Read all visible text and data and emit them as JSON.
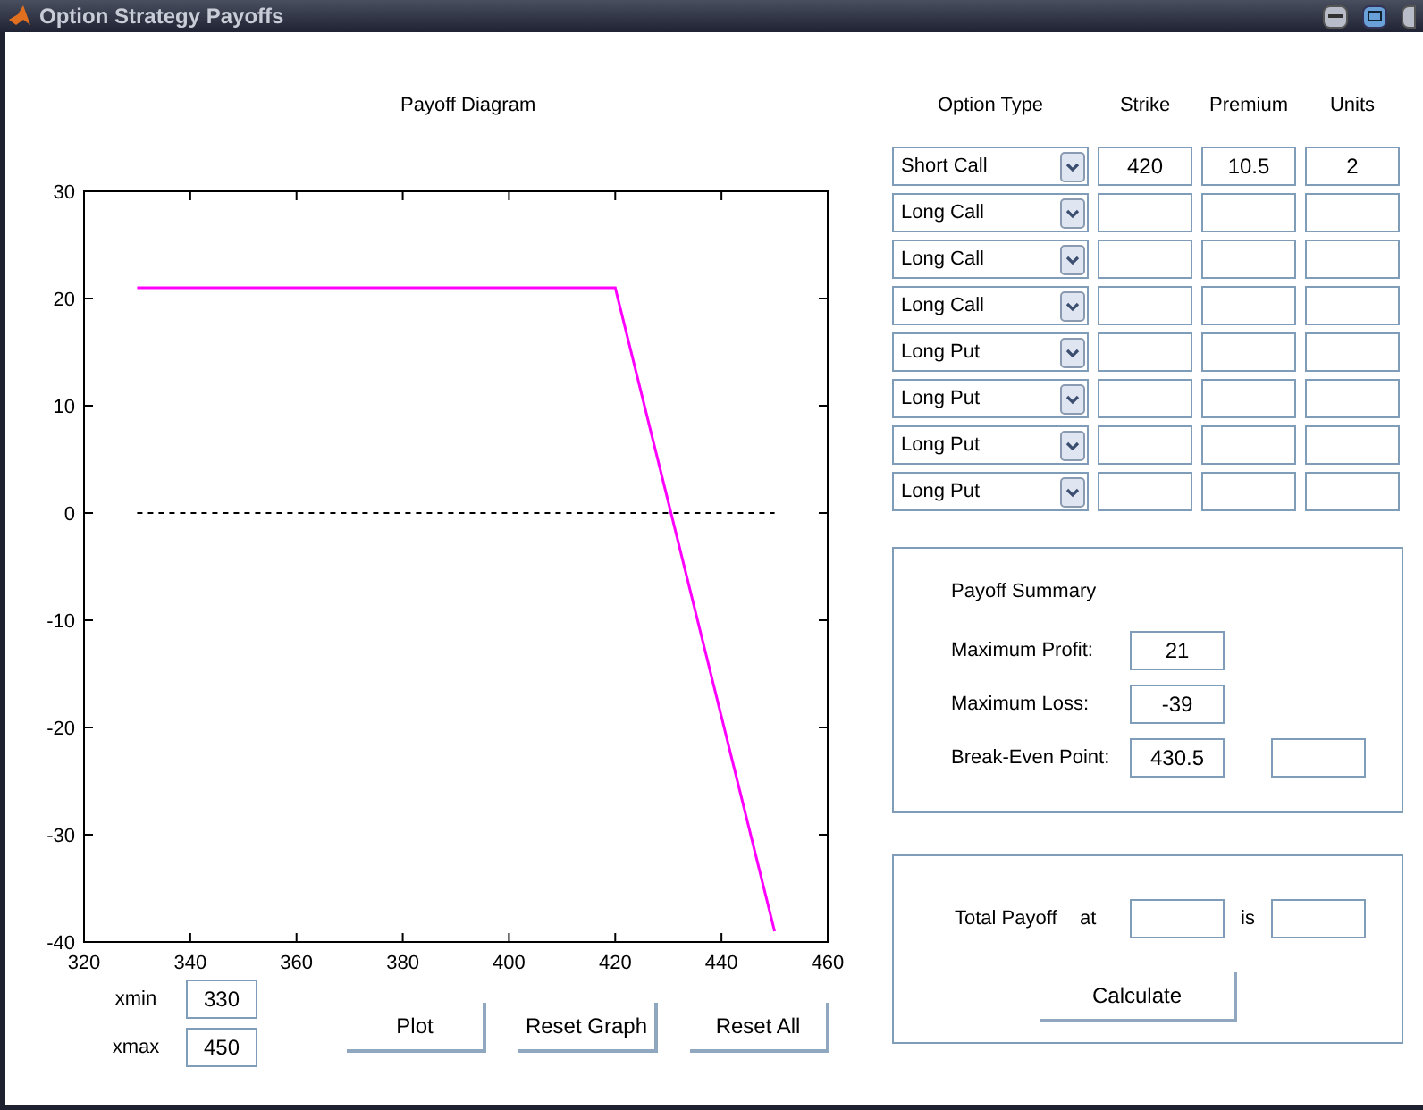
{
  "window": {
    "title": "Option Strategy Payoffs"
  },
  "plot": {
    "title": "Payoff Diagram",
    "chart_data": {
      "type": "line",
      "x": [
        330,
        420,
        450
      ],
      "series": [
        {
          "color": "#ff00ff",
          "line_style": "solid",
          "values": [
            21,
            21,
            -39
          ]
        },
        {
          "color": "#000000",
          "line_style": "dashed",
          "values": [
            0,
            0,
            0
          ]
        }
      ],
      "xlim": [
        320,
        460
      ],
      "ylim": [
        -40,
        30
      ],
      "xticks": [
        320,
        340,
        360,
        380,
        400,
        420,
        440,
        460
      ],
      "yticks": [
        -40,
        -30,
        -20,
        -10,
        0,
        10,
        20,
        30
      ]
    }
  },
  "range": [
    {
      "label": "xmin",
      "value": "330"
    },
    {
      "label": "xmax",
      "value": "450"
    }
  ],
  "buttons": [
    "Plot",
    "Reset Graph",
    "Reset All"
  ],
  "legs": {
    "columns": [
      "Option Type",
      "Strike",
      "Premium",
      "Units"
    ],
    "rows": [
      {
        "type": "Short Call",
        "strike": "420",
        "premium": "10.5",
        "units": "2"
      },
      {
        "type": "Long Call"
      },
      {
        "type": "Long Call"
      },
      {
        "type": "Long Call"
      },
      {
        "type": "Long Put"
      },
      {
        "type": "Long Put"
      },
      {
        "type": "Long Put"
      },
      {
        "type": "Long Put"
      }
    ]
  },
  "summary": {
    "title": "Payoff Summary",
    "max_profit": {
      "label": "Maximum Profit:",
      "value": "21"
    },
    "max_loss": {
      "label": "Maximum Loss:",
      "value": "-39"
    },
    "break_even": {
      "label": "Break-Even Point:",
      "values": [
        "430.5"
      ]
    }
  },
  "total": {
    "label": "Total Payoff",
    "at": "at",
    "is": "is",
    "button": "Calculate"
  }
}
